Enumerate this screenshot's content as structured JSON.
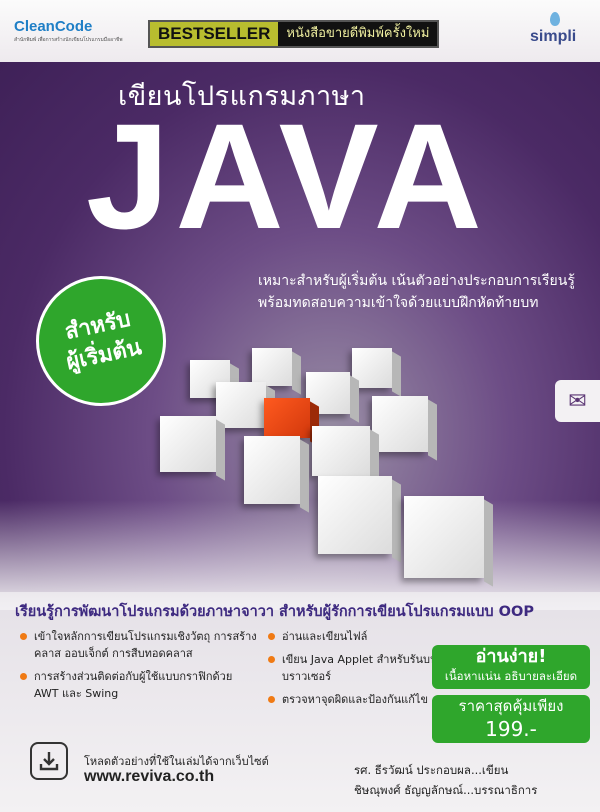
{
  "publisher": {
    "name": "CleanCode",
    "tagline": "สำนักพิมพ์ เพื่อการสร้างนักเขียนโปรแกรมมืออาชีพ"
  },
  "badge": {
    "bestseller": "BESTSELLER",
    "reprint": "หนังสือขายดีพิมพ์ครั้งใหม่"
  },
  "imprint": {
    "name": "simpli"
  },
  "title": {
    "subtitle": "เขียนโปรแกรมภาษา",
    "main": "JAVA"
  },
  "description": {
    "line1": "เหมาะสำหรับผู้เริ่มต้น เน้นตัวอย่างประกอบการเรียนรู้",
    "line2": "พร้อมทดสอบความเข้าใจด้วยแบบฝึกหัดท้ายบท"
  },
  "circle": {
    "line1": "สำหรับ",
    "line2": "ผู้เริ่มต้น"
  },
  "headline": "เรียนรู้การพัฒนาโปรแกรมด้วยภาษาจาวา สำหรับผู้รักการเขียนโปรแกรมแบบ OOP",
  "bullets_left": [
    "เข้าใจหลักการเขียนโปรแกรมเชิงวัตถุ การสร้างคลาส ออบเจ็กต์ การสืบทอดคลาส",
    "การสร้างส่วนติดต่อกับผู้ใช้แบบกราฟิกด้วย AWT และ Swing"
  ],
  "bullets_right": [
    "อ่านและเขียนไฟล์",
    "เขียน Java Applet สำหรับรันบนบราวเซอร์",
    "ตรวจหาจุดผิดและป้องกันแก้ไข"
  ],
  "promo": {
    "easy": "อ่านง่าย!",
    "easy_sub": "เนื้อหาแน่น อธิบายละเอียด",
    "price_label": "ราคาสุดคุ้มเพียง",
    "price": "199.-"
  },
  "download": {
    "text": "โหลดตัวอย่างที่ใช้ในเล่มได้จากเว็บไซต์",
    "url": "www.reviva.co.th"
  },
  "authors": {
    "writer": "รศ. ธีรวัฒน์ ประกอบผล...เขียน",
    "editor": "ชิษณุพงศ์ ธัญญลักษณ์...บรรณาธิการ"
  },
  "colors": {
    "purple": "#4b2a65",
    "green": "#2fa62c",
    "accent": "#f07a14",
    "red_cube": "#e0461a"
  }
}
